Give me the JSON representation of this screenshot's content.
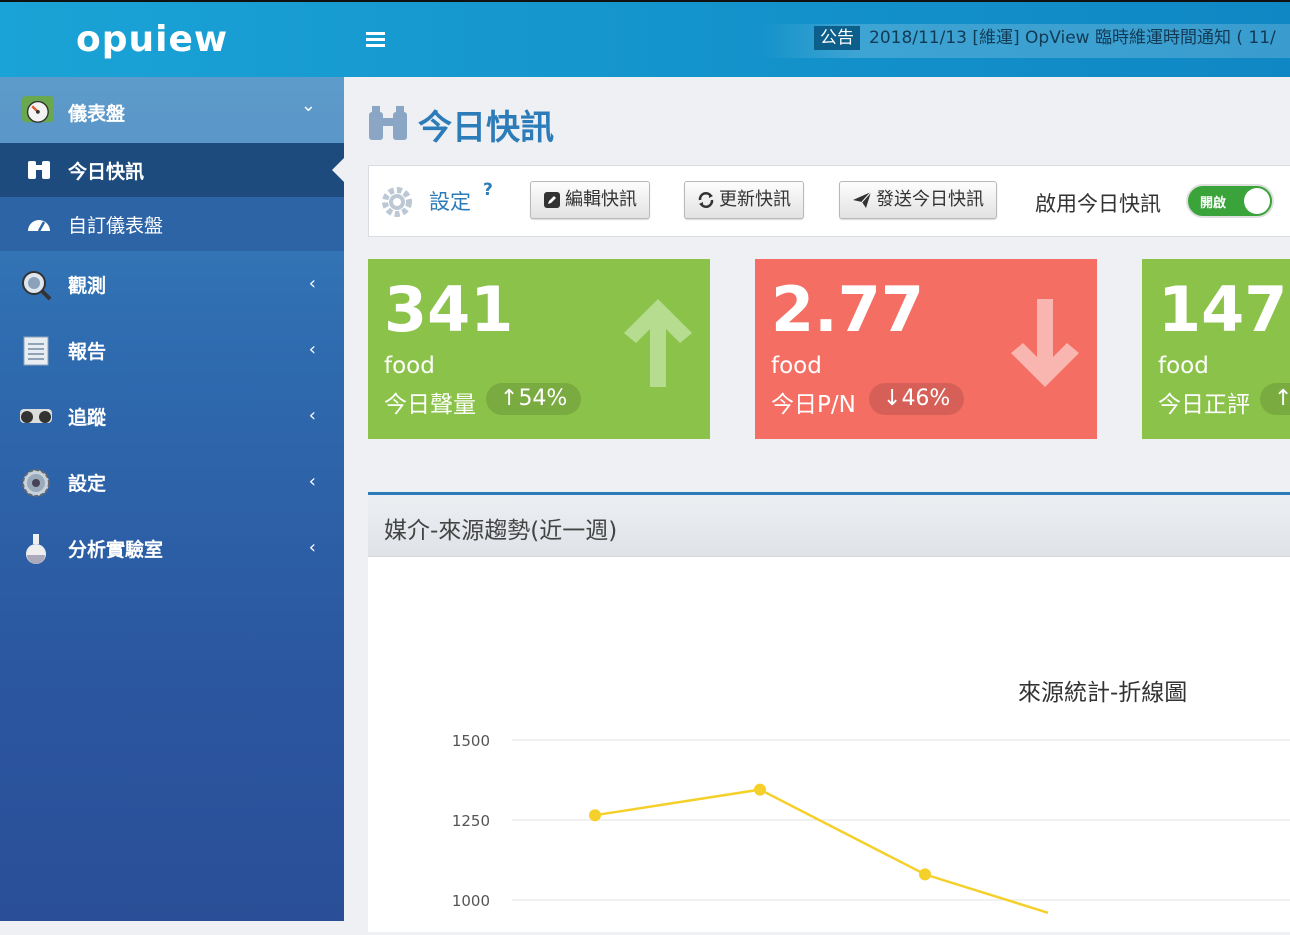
{
  "app": {
    "logo": "opuiew"
  },
  "header": {
    "announce_badge": "公告",
    "announce_text": "2018/11/13  [維運] OpView 臨時維運時間通知 ( 11/"
  },
  "sidebar": {
    "groups": [
      {
        "label": "儀表盤",
        "icon": "dashboard-gauge-icon",
        "chevron": "⌄"
      },
      {
        "label": "觀測",
        "icon": "magnifier-icon",
        "chevron": "‹"
      },
      {
        "label": "報告",
        "icon": "report-icon",
        "chevron": "‹"
      },
      {
        "label": "追蹤",
        "icon": "binoculars-icon",
        "chevron": "‹"
      },
      {
        "label": "設定",
        "icon": "gear-icon",
        "chevron": "‹"
      },
      {
        "label": "分析實驗室",
        "icon": "flask-icon",
        "chevron": "‹"
      }
    ],
    "subitems": [
      {
        "label": "今日快訊",
        "icon": "binoculars-icon"
      },
      {
        "label": "自訂儀表盤",
        "icon": "tachometer-icon"
      }
    ]
  },
  "page": {
    "title": "今日快訊"
  },
  "toolbar": {
    "settings_label": "設定",
    "help": "?",
    "edit_label": "編輯快訊",
    "refresh_label": "更新快訊",
    "send_label": "發送今日快訊",
    "enable_label": "啟用今日快訊",
    "toggle_label": "開啟",
    "toggle_on": true
  },
  "cards": [
    {
      "value": "341",
      "keyword": "food",
      "label": "今日聲量",
      "change": "54%",
      "direction": "up",
      "color": "#8bc34a"
    },
    {
      "value": "2.77",
      "keyword": "food",
      "label": "今日P/N",
      "change": "46%",
      "direction": "down",
      "color": "#f46e63"
    },
    {
      "value": "147",
      "keyword": "food",
      "label": "今日正評",
      "change": "",
      "direction": "up",
      "color": "#8bc34a"
    }
  ],
  "panel": {
    "title": "媒介-來源趨勢(近一週)"
  },
  "chart_data": {
    "type": "line",
    "title": "來源統計-折線圖",
    "yticks": [
      1000,
      1250,
      1500
    ],
    "series": [
      {
        "values": [
          1265,
          1345,
          1080,
          960
        ],
        "color": "#f5d02b"
      }
    ]
  }
}
